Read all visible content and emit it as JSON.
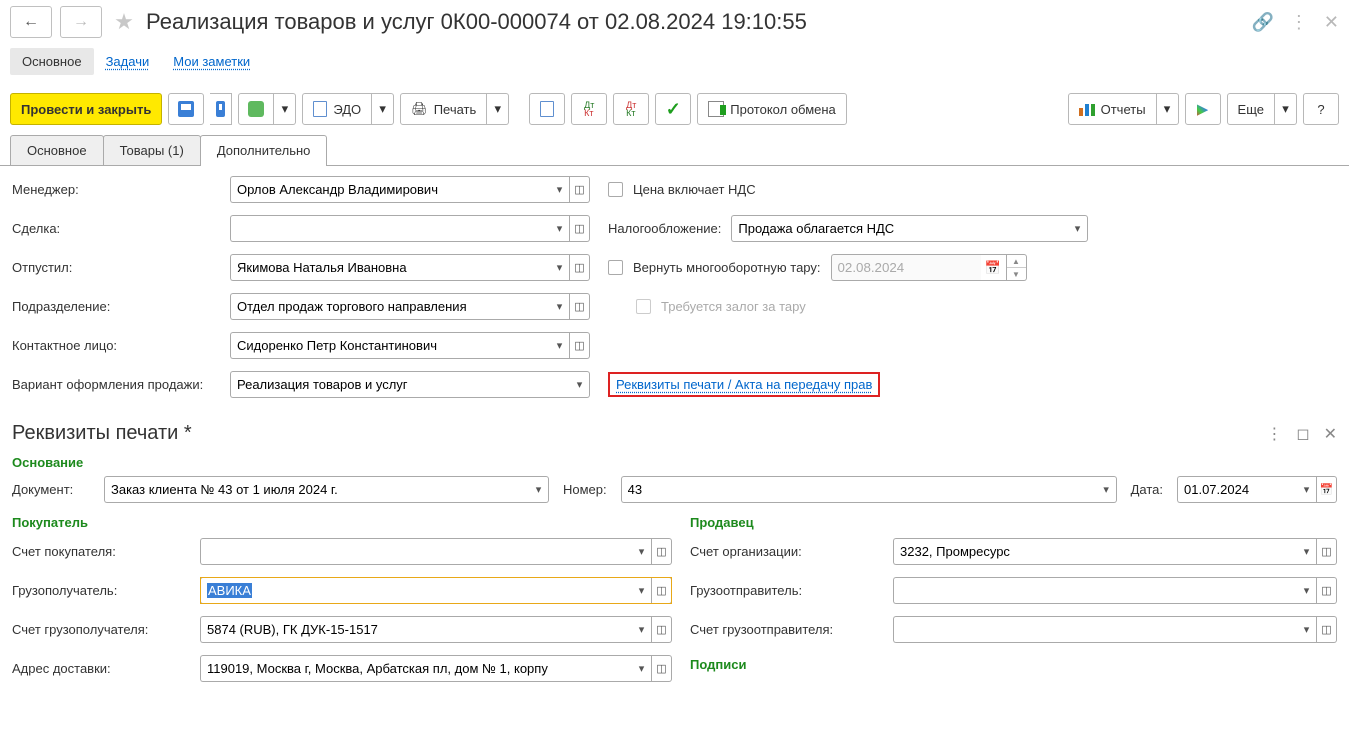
{
  "header": {
    "title": "Реализация товаров и услуг 0К00-000074 от 02.08.2024 19:10:55"
  },
  "nav": {
    "main": "Основное",
    "tasks": "Задачи",
    "notes": "Мои заметки"
  },
  "toolbar": {
    "post_close": "Провести и закрыть",
    "edo": "ЭДО",
    "print": "Печать",
    "dtcr1": "Дт",
    "dtcr1b": "Кт",
    "dtcr2": "Дт",
    "dtcr2b": "Кт",
    "proto": "Протокол обмена",
    "reports": "Отчеты",
    "more": "Еще",
    "help": "?"
  },
  "tabs": {
    "main": "Основное",
    "goods": "Товары (1)",
    "extra": "Дополнительно"
  },
  "form": {
    "manager_l": "Менеджер:",
    "manager_v": "Орлов Александр Владимирович",
    "price_incl_vat": "Цена включает НДС",
    "deal_l": "Сделка:",
    "tax_l": "Налогообложение:",
    "tax_v": "Продажа облагается НДС",
    "released_l": "Отпустил:",
    "released_v": "Якимова Наталья Ивановна",
    "return_tare": "Вернуть многооборотную тару:",
    "tare_date": "02.08.2024",
    "dept_l": "Подразделение:",
    "dept_v": "Отдел продаж торгового направления",
    "deposit_tare": "Требуется залог за тару",
    "contact_l": "Контактное лицо:",
    "contact_v": "Сидоренко Петр Константинович",
    "variant_l": "Вариант оформления продажи:",
    "variant_v": "Реализация товаров и услуг",
    "print_req_link": "Реквизиты печати / Акта на передачу прав"
  },
  "subwin": {
    "title": "Реквизиты печати *",
    "basis_grp": "Основание",
    "doc_l": "Документ:",
    "doc_v": "Заказ клиента № 43 от 1 июля 2024 г.",
    "num_l": "Номер:",
    "num_v": "43",
    "date_l": "Дата:",
    "date_v": "01.07.2024",
    "buyer_grp": "Покупатель",
    "seller_grp": "Продавец",
    "buyer_acc_l": "Счет покупателя:",
    "seller_acc_l": "Счет организации:",
    "seller_acc_v": "3232, Промресурс",
    "consignee_l": "Грузополучатель:",
    "consignee_v": "АВИКА",
    "shipper_l": "Грузоотправитель:",
    "consignee_acc_l": "Счет грузополучателя:",
    "consignee_acc_v": "5874 (RUB), ГК ДУК-15-1517",
    "shipper_acc_l": "Счет грузоотправителя:",
    "addr_l": "Адрес доставки:",
    "addr_v": "119019, Москва г, Москва, Арбатская пл, дом № 1, корпу",
    "sign_grp": "Подписи"
  }
}
